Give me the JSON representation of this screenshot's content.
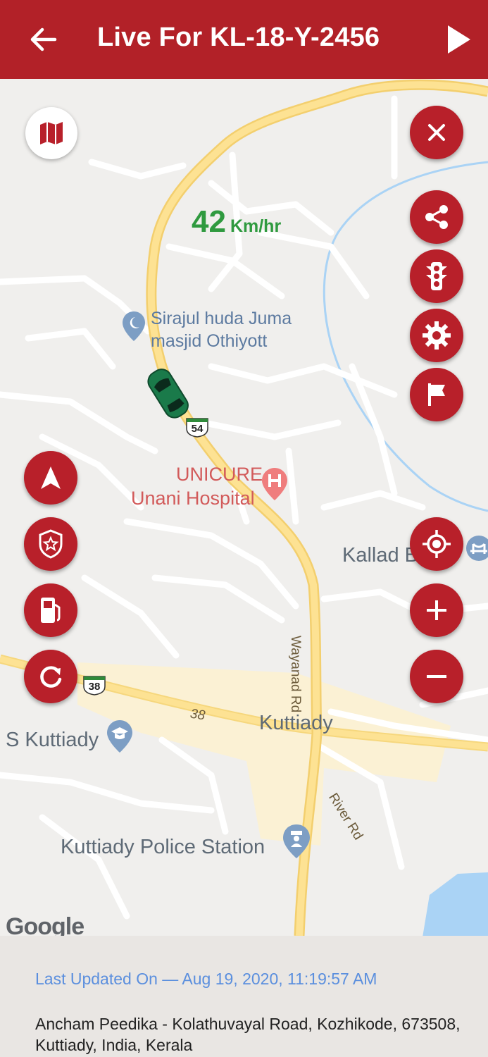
{
  "appbar": {
    "title": "Live For KL-18-Y-2456",
    "back_icon": "arrow-left-icon",
    "play_icon": "play-icon"
  },
  "speed": {
    "value": "42",
    "unit": "Km/hr"
  },
  "map": {
    "labels": {
      "mosque": "Sirajul huda Juma masjid Othiyott",
      "hospital_1": "UNICURE",
      "hospital_2": "Unani Hospital",
      "kallad": "Kallad B",
      "kuttiady": "Kuttiady",
      "s_kuttiady": "S Kuttiady",
      "police": "Kuttiady Police Station",
      "wayanad_rd": "Wayanad Rd",
      "river_rd": "River Rd",
      "route_54": "54",
      "route_38": "38",
      "road_38": "38",
      "attribution": "Google"
    }
  },
  "footer": {
    "last_updated": "Last Updated On — Aug 19, 2020, 11:19:57 AM",
    "address": "Ancham Peedika - Kolathuvayal Road, Kozhikode, 673508, Kuttiady, India, Kerala"
  },
  "colors": {
    "accent": "#b8202a",
    "speed": "#2f9a3f",
    "link": "#5b8fde"
  }
}
